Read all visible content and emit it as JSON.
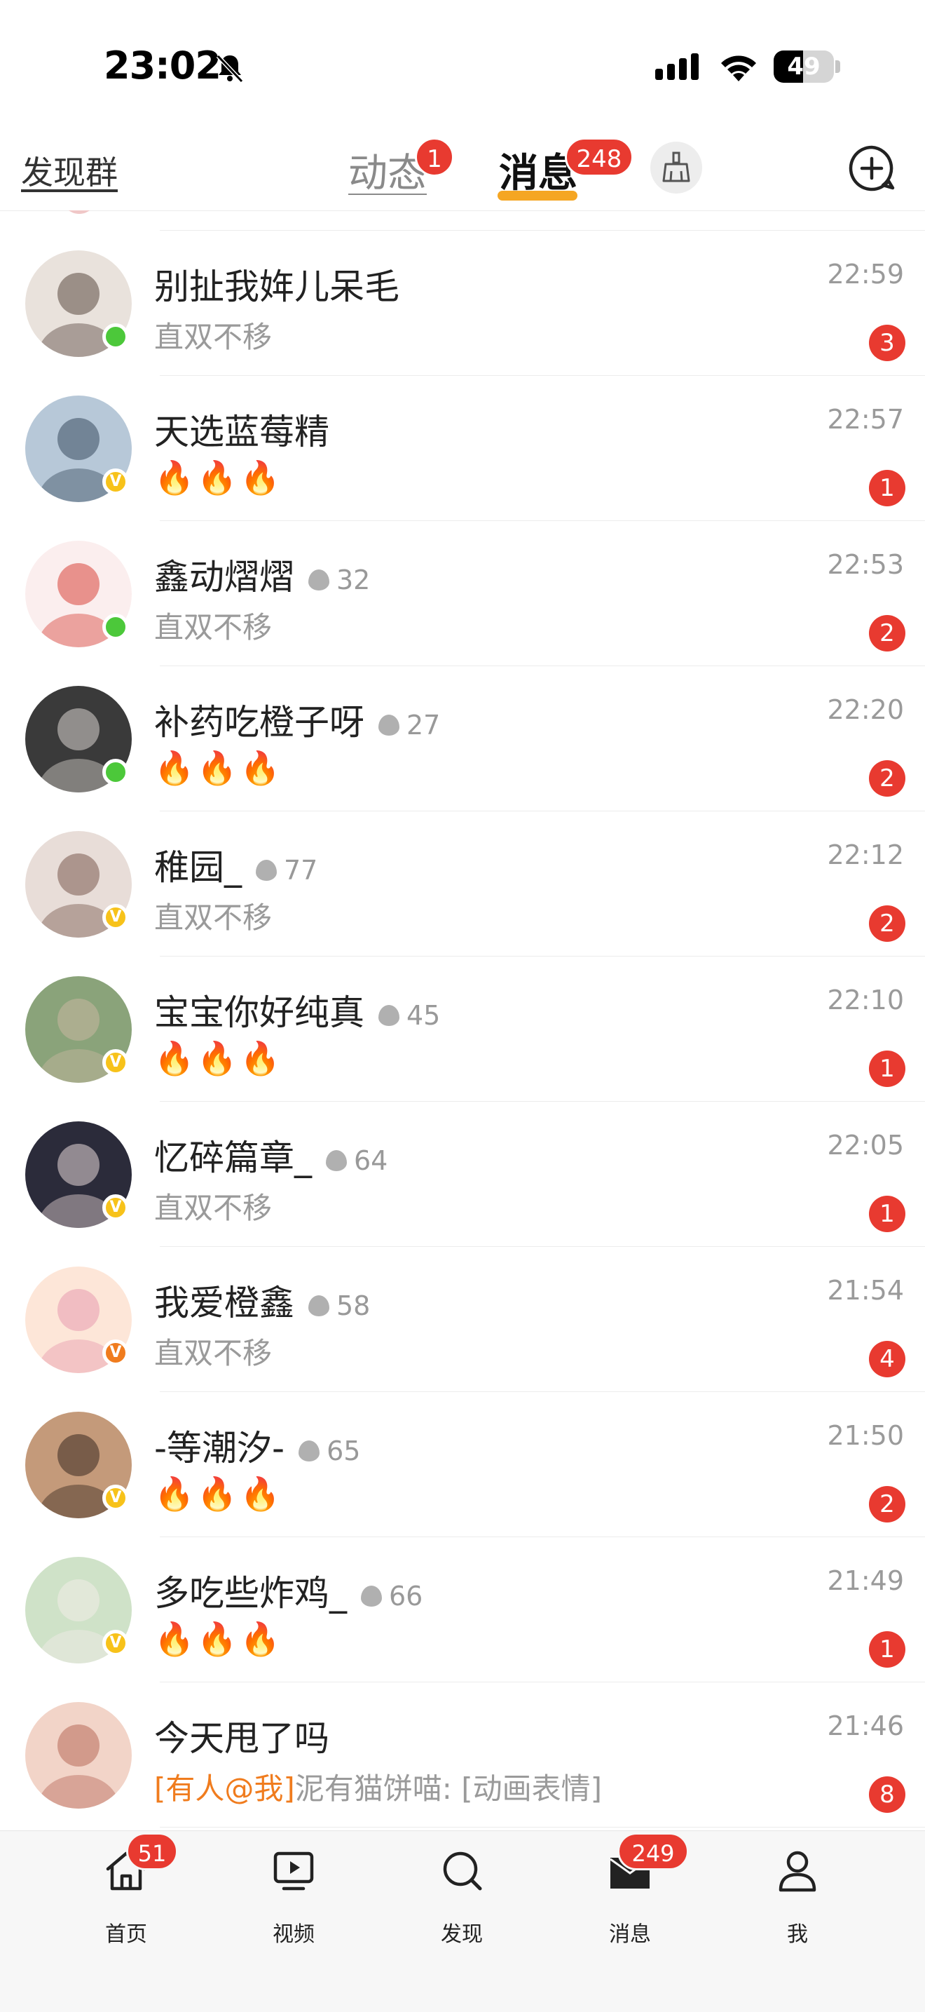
{
  "status_bar": {
    "time": "23:02",
    "battery": "49",
    "battery_level": 0.49
  },
  "header": {
    "discover_group": "发现群",
    "tabs": [
      {
        "label": "动态",
        "badge": "1"
      },
      {
        "label": "消息",
        "badge": "248"
      }
    ]
  },
  "conversations": [
    {
      "name": "别扯我姩儿呆毛",
      "fire_count": "",
      "preview": "直双不移",
      "time": "22:59",
      "unread": "3",
      "status": "online"
    },
    {
      "name": "天选蓝莓精",
      "fire_count": "",
      "preview": "🔥🔥🔥",
      "time": "22:57",
      "unread": "1",
      "status": "verified"
    },
    {
      "name": "鑫动熠熠",
      "fire_count": "32",
      "preview": "直双不移",
      "time": "22:53",
      "unread": "2",
      "status": "online"
    },
    {
      "name": "补药吃橙子呀",
      "fire_count": "27",
      "preview": "🔥🔥🔥",
      "time": "22:20",
      "unread": "2",
      "status": "online"
    },
    {
      "name": "稚园_",
      "fire_count": "77",
      "preview": "直双不移",
      "time": "22:12",
      "unread": "2",
      "status": "verified"
    },
    {
      "name": "宝宝你好纯真",
      "fire_count": "45",
      "preview": "🔥🔥🔥",
      "time": "22:10",
      "unread": "1",
      "status": "verified"
    },
    {
      "name": "忆碎篇章_",
      "fire_count": "64",
      "preview": "直双不移",
      "time": "22:05",
      "unread": "1",
      "status": "verified"
    },
    {
      "name": "我爱橙鑫",
      "fire_count": "58",
      "preview": "直双不移",
      "time": "21:54",
      "unread": "4",
      "status": "verified-orange"
    },
    {
      "name": "-等潮汐-",
      "fire_count": "65",
      "preview": "🔥🔥🔥",
      "time": "21:50",
      "unread": "2",
      "status": "verified"
    },
    {
      "name": "多吃些炸鸡_",
      "fire_count": "66",
      "preview": "🔥🔥🔥",
      "time": "21:49",
      "unread": "1",
      "status": "verified"
    },
    {
      "name": "今天甩了吗",
      "fire_count": "",
      "mention": "[有人@我]",
      "preview": "泥有猫饼喵: [动画表情]",
      "time": "21:46",
      "unread": "8",
      "status": ""
    }
  ],
  "verified_mark": "V",
  "bottom_nav": [
    {
      "label": "首页",
      "badge": "51",
      "icon": "home-icon"
    },
    {
      "label": "视频",
      "badge": "",
      "icon": "video-icon"
    },
    {
      "label": "发现",
      "badge": "",
      "icon": "search-icon"
    },
    {
      "label": "消息",
      "badge": "249",
      "icon": "message-icon"
    },
    {
      "label": "我",
      "badge": "",
      "icon": "profile-icon"
    }
  ],
  "colors": {
    "accent": "#f5a623",
    "badge": "#e83a30",
    "online": "#4cc83a",
    "verified": "#f7c21a",
    "mention": "#f07c1e"
  }
}
